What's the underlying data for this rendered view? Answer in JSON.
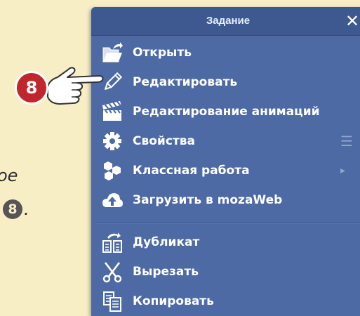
{
  "background": {
    "text_line1": "oe",
    "text_line2_badge": "8",
    "text_line2_end": "."
  },
  "callout": {
    "number": "8"
  },
  "panel": {
    "title": "Задание",
    "close_glyph": "✕",
    "colors": {
      "panel": "#4d6aa4",
      "header": "#3e5890",
      "badge": "#c0262c"
    },
    "items": [
      {
        "label": "Открыть",
        "icon": "folder-open-icon"
      },
      {
        "label": "Редактировать",
        "icon": "pencil-icon"
      },
      {
        "label": "Редактирование анимаций",
        "icon": "clapperboard-icon"
      },
      {
        "label": "Свойства",
        "icon": "gear-icon",
        "extra": "☰"
      },
      {
        "label": "Классная работа",
        "icon": "hexagons-icon",
        "extra": "▸"
      },
      {
        "label": "Загрузить в mozaWeb",
        "icon": "cloud-upload-icon"
      },
      {
        "label": "Дубликат",
        "icon": "duplicate-icon"
      },
      {
        "label": "Вырезать",
        "icon": "scissors-icon"
      },
      {
        "label": "Копировать",
        "icon": "copy-icon"
      }
    ]
  }
}
